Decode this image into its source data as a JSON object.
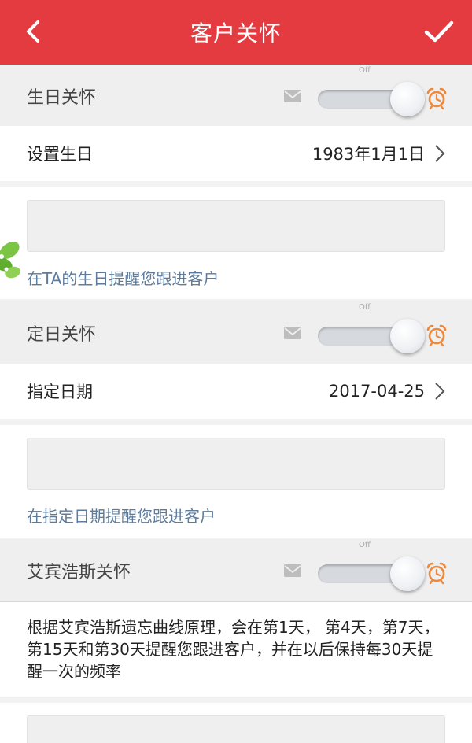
{
  "header": {
    "title": "客户关怀",
    "back_icon": "chevron-left-icon",
    "confirm_icon": "check-icon"
  },
  "birthday": {
    "section_label": "生日关怀",
    "switch_state_label": "Off",
    "row_label": "设置生日",
    "row_value": "1983年1月1日",
    "hint": "在TA的生日提醒您跟进客户"
  },
  "fixed_date": {
    "section_label": "定日关怀",
    "switch_state_label": "Off",
    "row_label": "指定日期",
    "row_value": "2017-04-25",
    "hint": "在指定日期提醒您跟进客户"
  },
  "ebbinghaus": {
    "section_label": "艾宾浩斯关怀",
    "switch_state_label": "Off",
    "description": "根据艾宾浩斯遗忘曲线原理，会在第1天， 第4天，第7天， 第15天和第30天提醒您跟进客户，并在以后保持每30天提醒一次的频率"
  },
  "colors": {
    "accent": "#e33b3f",
    "hint": "#5d7b9b",
    "alarm": "#f0883a"
  }
}
